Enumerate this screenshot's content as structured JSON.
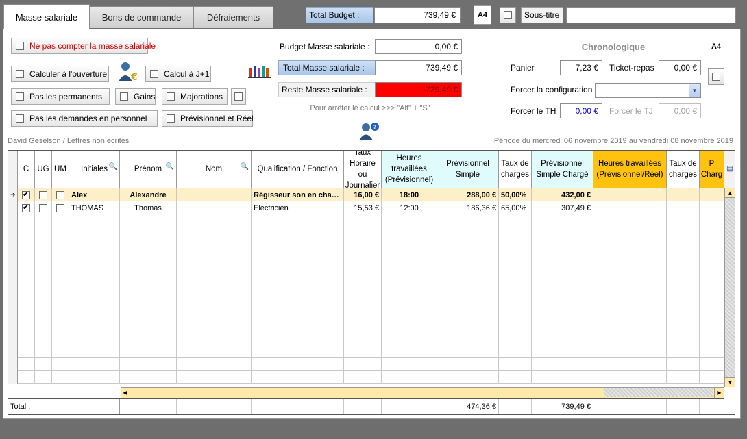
{
  "tabs": [
    {
      "label": "Masse salariale",
      "active": true
    },
    {
      "label": "Bons de commande",
      "active": false
    },
    {
      "label": "Défraiements",
      "active": false
    }
  ],
  "header": {
    "total_budget_label": "Total Budget :",
    "total_budget_value": "739,49 €",
    "sous_titre_label": "Sous-titre",
    "sous_titre_value": "",
    "a4_label": "A4"
  },
  "options": {
    "ne_pas_compter": "Ne pas compter la masse salariale",
    "calculer_ouverture": "Calculer à l'ouverture",
    "calcul_j1": "Calcul à J+1",
    "pas_permanents": "Pas les permanents",
    "gains": "Gains",
    "majorations": "Majorations",
    "pas_demandes": "Pas les demandes en personnel",
    "previsionnel_reel": "Prévisionnel et Réel"
  },
  "budget": {
    "budget_masse_label": "Budget Masse salariale :",
    "budget_masse_value": "0,00 €",
    "total_masse_label": "Total Masse salariale :",
    "total_masse_value": "739,49 €",
    "reste_masse_label": "Reste Masse salariale :",
    "reste_masse_value": "-739,49 €",
    "stop_hint": "Pour arrêter le calcul >>> \"Alt\" + \"S\""
  },
  "right": {
    "chronologique": "Chronologique",
    "a4_label": "A4",
    "panier_label": "Panier",
    "panier_value": "7,23 €",
    "ticket_label": "Ticket-repas",
    "ticket_value": "0,00 €",
    "forcer_config_label": "Forcer la configuration",
    "forcer_config_value": "",
    "forcer_th_label": "Forcer le TH",
    "forcer_th_value": "0,00 €",
    "forcer_tj_label": "Forcer le TJ",
    "forcer_tj_value": "0,00 €"
  },
  "info": {
    "user": "David Geselson / Lettres non ecrites",
    "periode": "Période du mercredi 06 novembre 2019 au vendredi 08 novembre 2019"
  },
  "table": {
    "columns": [
      "C",
      "UG",
      "UM",
      "Initiales",
      "Prénom",
      "Nom",
      "Qualification / Fonction",
      "Taux Horaire ou Journalier",
      "Heures travaillées (Prévisionnel)",
      "Prévisionnel Simple",
      "Taux de charges",
      "Prévisionnel Simple Chargé",
      "Heures travaillées (Prévisionnel/Réel)",
      "Taux de charges",
      "P Charg"
    ],
    "rows": [
      {
        "c": true,
        "ug": false,
        "um": false,
        "initiales": "Alex",
        "prenom": "Alexandre",
        "nom": "",
        "qualif": "Régisseur son en cha…",
        "taux": "16,00 €",
        "heures": "18:00",
        "prev": "288,00 €",
        "charges": "50,00%",
        "prev_charge": "432,00 €",
        "selected": true
      },
      {
        "c": true,
        "ug": false,
        "um": false,
        "initiales": "THOMAS",
        "prenom": "Thomas",
        "nom": "",
        "qualif": "Electricien",
        "taux": "15,53 €",
        "heures": "12:00",
        "prev": "186,36 €",
        "charges": "65,00%",
        "prev_charge": "307,49 €",
        "selected": false
      }
    ],
    "total_label": "Total :",
    "total_prev": "474,36 €",
    "total_prev_charge": "739,49 €"
  },
  "colors": {
    "accent_blue": "#a9c6ea",
    "reste_red": "#ff0000",
    "orange_col": "#ffc20e",
    "cyan_col": "#e0fbfb"
  }
}
